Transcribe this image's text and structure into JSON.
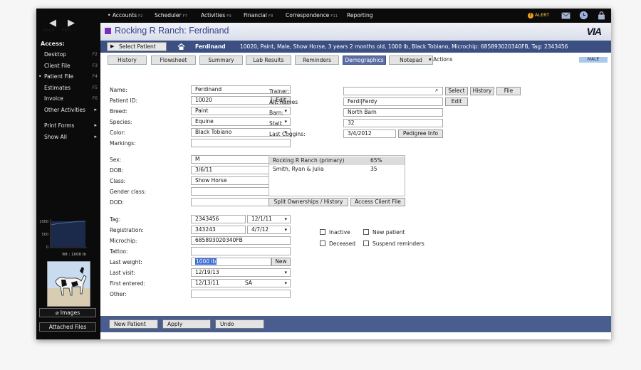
{
  "nav": {
    "back": "BACK",
    "fwd": "FWD"
  },
  "menu": [
    {
      "label": "Accounts",
      "key": "F2"
    },
    {
      "label": "Scheduler",
      "key": "F7"
    },
    {
      "label": "Activities",
      "key": "F9"
    },
    {
      "label": "Financial",
      "key": "F8"
    },
    {
      "label": "Correspondence",
      "key": "F11"
    },
    {
      "label": "Reporting",
      "key": ""
    }
  ],
  "alert_label": "ALERT",
  "sidebar": {
    "access_title": "Access:",
    "items": [
      {
        "label": "Desktop",
        "key": "F2"
      },
      {
        "label": "Client File",
        "key": "F3"
      },
      {
        "label": "Patient File",
        "key": "F4"
      },
      {
        "label": "Estimates",
        "key": "F5"
      },
      {
        "label": "Invoice",
        "key": "F6"
      },
      {
        "label": "Other Activities",
        "key": ""
      },
      {
        "label": "Print Forms",
        "key": ""
      },
      {
        "label": "Show All",
        "key": ""
      }
    ],
    "chart": {
      "y_ticks": [
        "1000",
        "500",
        "0"
      ],
      "caption": "Wt : 1000 lb"
    },
    "images_button": "Images",
    "attached_files_button": "Attached Files"
  },
  "header": {
    "title": "Rocking R Ranch:  Ferdinand",
    "logo": "VIA"
  },
  "patient_bar": {
    "select_button": "Select Patient",
    "name": "Ferdinand",
    "info": "10020,  Paint,  Male,  Show Horse,  3 years 2 months old,  1000 lb,  Black Tobiano,  Microchip: 685893020340FB,  Tag: 2343456"
  },
  "tabs": [
    "History",
    "Flowsheet",
    "Summary",
    "Lab Results",
    "Reminders",
    "Demographics",
    "Notepad"
  ],
  "actions_label": "Actions",
  "sex_badge": "MALE",
  "form": {
    "name_label": "Name:",
    "name": "Ferdinand",
    "patient_id_label": "Patient ID:",
    "patient_id": "10020",
    "edit": "Edit",
    "breed_label": "Breed:",
    "breed": "Paint",
    "species_label": "Species:",
    "species": "Equine",
    "color_label": "Color:",
    "color": "Black Tobiano",
    "markings_label": "Markings:",
    "markings": "",
    "sex_label": "Sex:",
    "sex": "M",
    "dob_label": "DOB:",
    "dob": "3/6/11",
    "class_label": "Class:",
    "class": "Show Horse",
    "gender_class_label": "Gender class:",
    "gender_class": "",
    "dod_label": "DOD:",
    "dod": "",
    "tag_label": "Tag:",
    "tag": "2343456",
    "tag_date": "12/1/11",
    "registration_label": "Registration:",
    "registration": "343243",
    "registration_date": "4/7/12",
    "microchip_label": "Microchip:",
    "microchip": "685893020340FB",
    "tattoo_label": "Tattoo:",
    "tattoo": "",
    "last_weight_label": "Last weight:",
    "last_weight": "1000 lb",
    "new": "New",
    "last_visit_label": "Last visit:",
    "last_visit": "12/19/13",
    "first_entered_label": "First entered:",
    "first_entered": "12/13/11",
    "first_entered_by": "SA",
    "other_label": "Other:",
    "other": ""
  },
  "right": {
    "trainer_label": "Trainer:",
    "trainer": "",
    "select": "Select",
    "history": "History",
    "file": "File",
    "alt_names_label": "Alt. names",
    "alt_names": "Ferdi|Ferdy",
    "edit": "Edit",
    "barn_label": "Barn:",
    "barn": "North Barn",
    "stall_label": "Stall:",
    "stall": "32",
    "last_coggins_label": "Last Coggins:",
    "last_coggins": "3/4/2012",
    "pedigree_info": "Pedigree Info"
  },
  "ownership": [
    {
      "name": "Rocking R Ranch (primary)",
      "pct": "65%"
    },
    {
      "name": "Smith, Ryan & Julia",
      "pct": "35"
    }
  ],
  "ownership_buttons": {
    "split": "Split Ownerships / History",
    "access": "Access Client File"
  },
  "checkboxes": {
    "inactive": "Inactive",
    "new_patient": "New patient",
    "deceased": "Deceased",
    "suspend_reminders": "Suspend reminders"
  },
  "footer": {
    "new_patient": "New Patient",
    "apply": "Apply",
    "undo": "Undo"
  },
  "colors": {
    "accent": "#3b4f83",
    "title": "#36428c",
    "tab_active": "#5b6fa6",
    "badge": "#a8c8ec"
  }
}
